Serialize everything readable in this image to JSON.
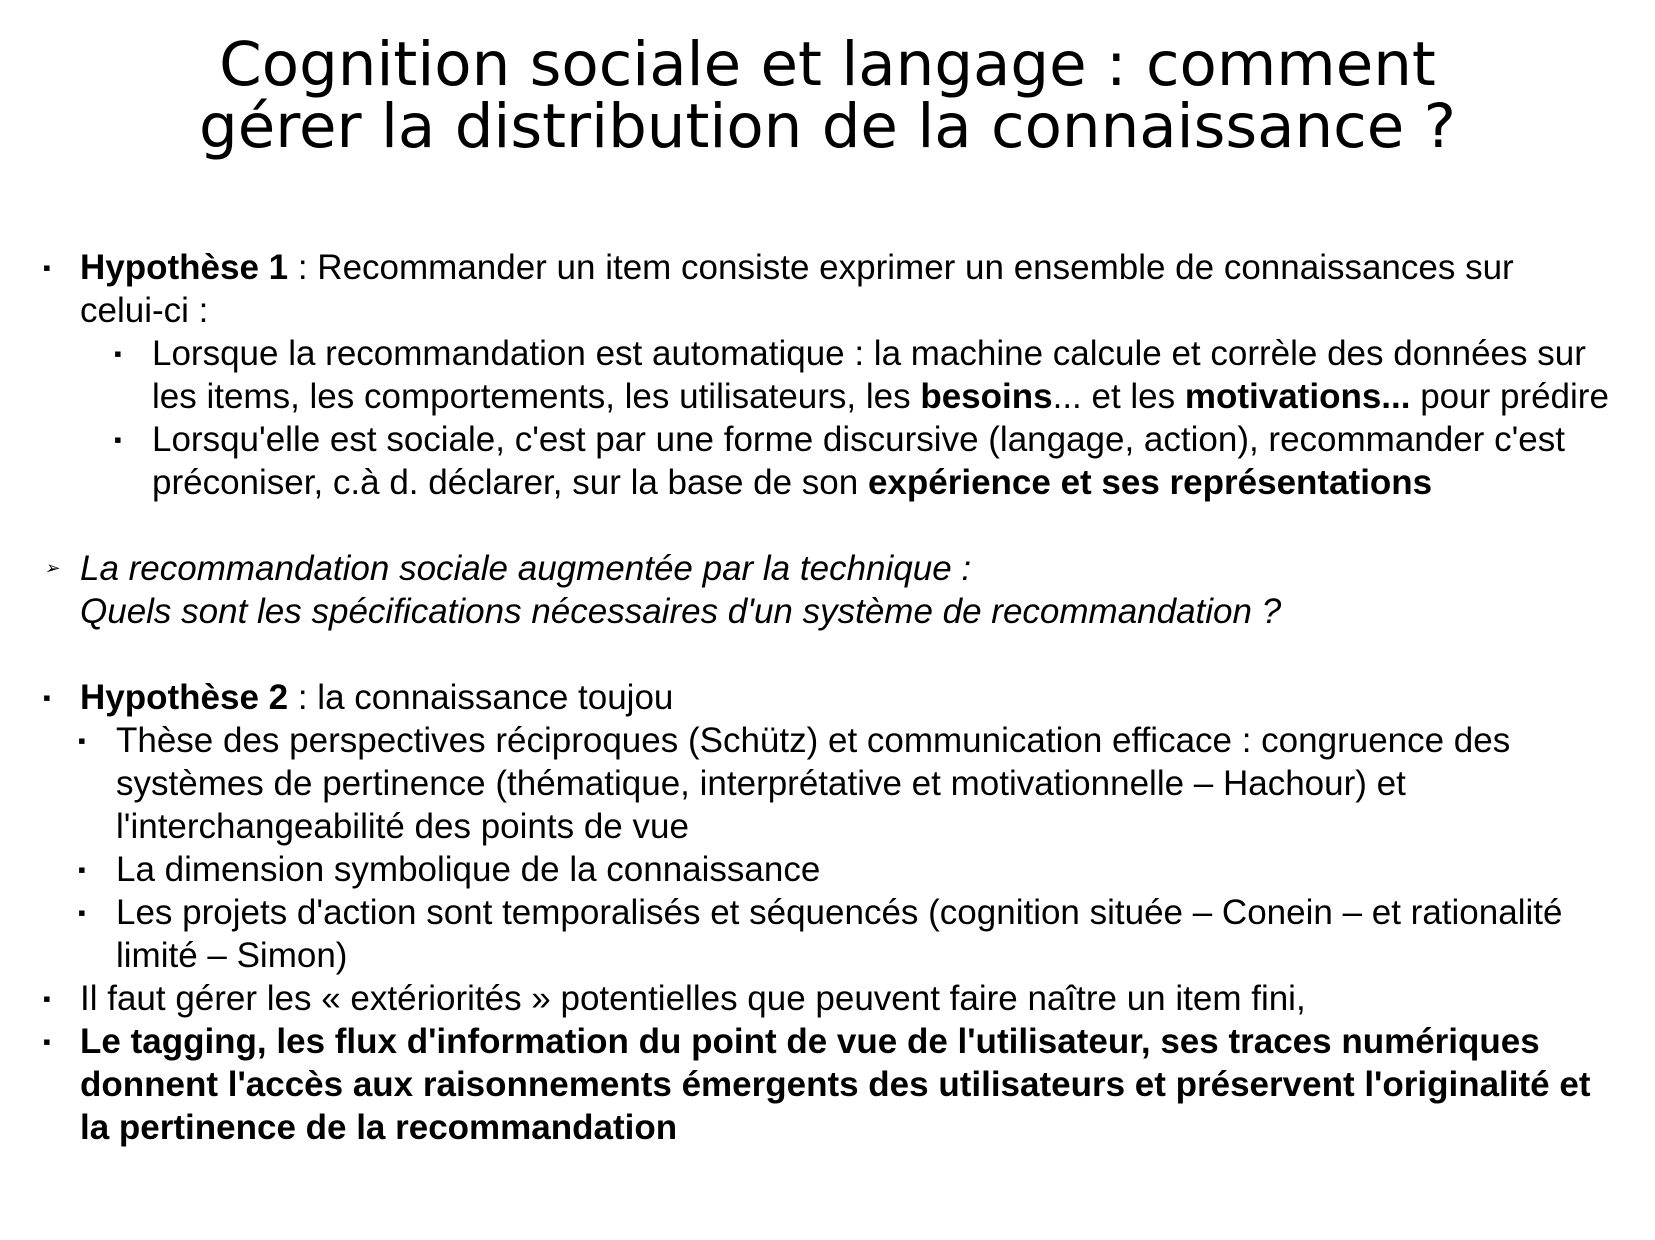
{
  "title": {
    "line1": "Cognition sociale et langage : comment",
    "line2": "gérer la distribution de la connaissance ?"
  },
  "bullets": {
    "square": "▪",
    "arrow": "➢"
  },
  "h1": {
    "label": "Hypothèse 1",
    "text": " : Recommander un item consiste exprimer un ensemble de connaissances sur celui-ci :",
    "sub1": {
      "t1": "Lorsque la recommandation est automatique : la machine calcule et corrèle des données sur les items, les comportements, les utilisateurs, les ",
      "b1": "besoins",
      "t2": "... et les ",
      "b2": "motivations...",
      "t3": " pour prédire"
    },
    "sub2": {
      "t1": "Lorsqu'elle est sociale, c'est par une forme discursive (langage, action), recommander c'est préconiser, c.à d. déclarer, sur la base de son ",
      "b1": "expérience et ses représentations"
    }
  },
  "arrow_item": {
    "line1": "La recommandation sociale augmentée par la technique :",
    "line2": "Quels sont les spécifications nécessaires d'un système de recommandation ?"
  },
  "h2": {
    "label": "Hypothèse 2",
    "text": " : la connaissance toujou",
    "sub1": "Thèse des perspectives réciproques (Schütz) et communication efficace : congruence des systèmes de pertinence (thématique, interprétative et motivationnelle – Hachour) et l'interchangeabilité des points de vue",
    "sub2": "La dimension symbolique de la connaissance",
    "sub3": "Les projets d'action sont temporalisés et séquencés (cognition située – Conein – et rationalité limité – Simon)"
  },
  "item_exteriorites": "Il faut gérer les « extériorités » potentielles que peuvent faire naître un item fini,",
  "item_tagging": "Le tagging, les flux d'information du point de vue de l'utilisateur, ses traces numériques donnent l'accès aux raisonnements émergents des utilisateurs et préservent l'originalité et la pertinence de la recommandation"
}
